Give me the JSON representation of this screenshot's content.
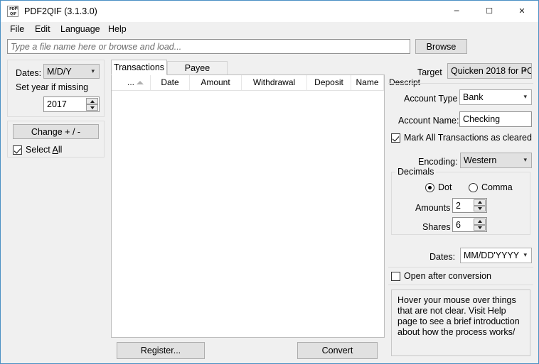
{
  "window": {
    "title": "PDF2QIF (3.1.3.0)",
    "icon": "pdf-qif-document-icon",
    "icon_line1": "PDF",
    "icon_line2": "QIF",
    "controls": {
      "minimize": "─",
      "maximize": "☐",
      "close": "✕"
    }
  },
  "menu": {
    "items": [
      {
        "label": "File"
      },
      {
        "label": "Edit"
      },
      {
        "label": "Language"
      },
      {
        "label": "Help"
      }
    ]
  },
  "file_row": {
    "placeholder": "Type a file name here or browse and load...",
    "value": "",
    "browse_label": "Browse"
  },
  "left_panel": {
    "dates_label": "Dates:",
    "dates_value": "M/D/Y",
    "set_year_label": "Set year if missing",
    "year_value": "2017",
    "change_button": "Change + / -",
    "select_all_label": "Select All",
    "select_all_accel": "A",
    "select_all_checked": true
  },
  "center": {
    "tabs": [
      {
        "label": "Transactions",
        "active": true
      },
      {
        "label": "Payee Mapping",
        "active": false
      }
    ],
    "table": {
      "columns": [
        "...",
        "Date",
        "Amount",
        "Withdrawal",
        "Deposit",
        "Name",
        "Descript"
      ],
      "sort_column": "...",
      "sort_direction": "ascending",
      "rows": []
    },
    "register_button": "Register...",
    "convert_button": "Convert"
  },
  "right_panel": {
    "target_label": "Target",
    "target_value": "Quicken 2018 for PC",
    "account_type_label": "Account Type",
    "account_type_value": "Bank",
    "account_name_label": "Account Name:",
    "account_name_value": "Checking",
    "mark_cleared_label": "Mark All Transactions as cleared",
    "mark_cleared_checked": true,
    "encoding_label": "Encoding:",
    "encoding_value": "Western",
    "decimals": {
      "legend": "Decimals",
      "dot_label": "Dot",
      "comma_label": "Comma",
      "separator_selected": "Dot",
      "amounts_label": "Amounts",
      "amounts_value": "2",
      "shares_label": "Shares",
      "shares_value": "6"
    },
    "dates_label": "Dates:",
    "dates_value": "MM/DD'YYYY",
    "open_after_label": "Open after conversion",
    "open_after_checked": false,
    "hint_text": "Hover your mouse over things that are not clear. Visit Help page to see a brief introduction about how the process works/"
  },
  "colors": {
    "window_bg": "#f0f0f0",
    "titlebar_bg": "#ffffff",
    "window_border": "#4a90c4",
    "field_bg": "#ffffff",
    "button_bg": "#e1e1e1",
    "button_border": "#adadad"
  }
}
